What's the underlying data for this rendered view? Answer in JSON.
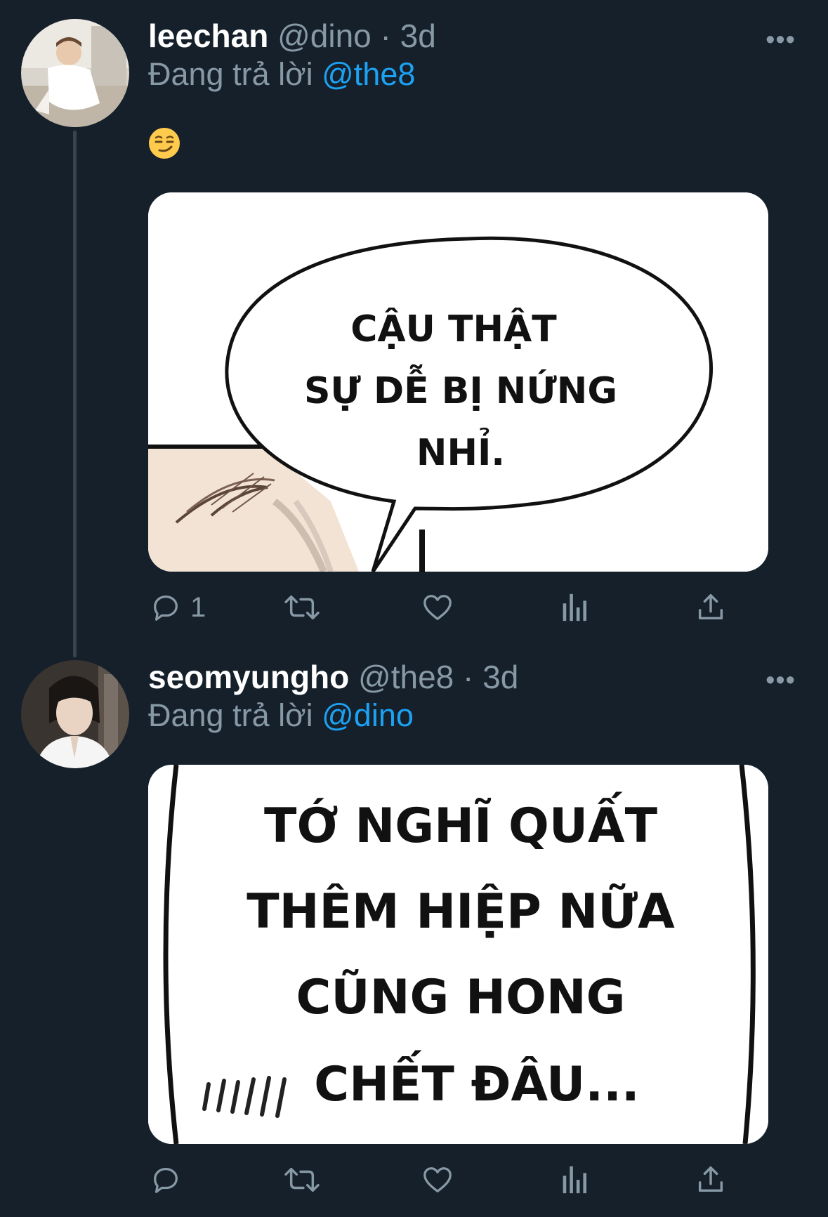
{
  "tweets": [
    {
      "name": "leechan",
      "handle": "@dino",
      "separator": "·",
      "time": "3d",
      "reply_prefix": "Đang trả lời",
      "reply_to": "@the8",
      "emoji": "smirking-face",
      "more_label": "•••",
      "media_text": [
        "CẬU THẬT",
        "SỰ DỄ BỊ NỨNG",
        "NHỈ."
      ],
      "actions": {
        "reply_count": "1",
        "retweet_count": "",
        "like_count": ""
      }
    },
    {
      "name": "seomyungho",
      "handle": "@the8",
      "separator": "·",
      "time": "3d",
      "reply_prefix": "Đang trả lời",
      "reply_to": "@dino",
      "more_label": "•••",
      "media_text": [
        "TỚ NGHĨ QUẤT",
        "THÊM HIỆP NỮA",
        "CŨNG HONG",
        "CHẾT ĐÂU..."
      ],
      "actions": {
        "reply_count": "",
        "retweet_count": "",
        "like_count": ""
      }
    }
  ],
  "colors": {
    "background": "#15202b",
    "text_secondary": "#8899a6",
    "mention": "#1da1f2",
    "thread_line": "#38444d"
  },
  "icons": [
    "reply-icon",
    "retweet-icon",
    "like-icon",
    "analytics-icon",
    "share-icon",
    "more-icon"
  ]
}
